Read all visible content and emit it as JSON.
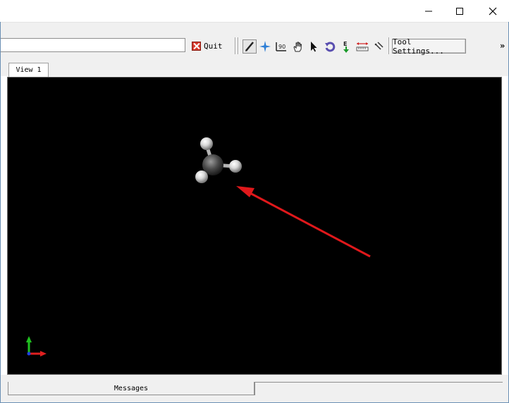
{
  "toolbar": {
    "quit_label": "Quit",
    "tool_settings_label": "Tool Settings...",
    "overflow_label": "»",
    "tools": [
      {
        "name": "draw-tool-icon"
      },
      {
        "name": "navigate-tool-icon"
      },
      {
        "name": "measure-angle-tool-icon"
      },
      {
        "name": "manipulate-hand-tool-icon"
      },
      {
        "name": "select-arrow-tool-icon"
      },
      {
        "name": "rotate-tool-icon"
      },
      {
        "name": "auto-optimize-tool-icon"
      },
      {
        "name": "ruler-measure-tool-icon"
      },
      {
        "name": "align-tool-icon"
      }
    ]
  },
  "tabs": {
    "view_label": "View 1"
  },
  "bottom": {
    "messages_label": "Messages"
  },
  "colors": {
    "viewport_bg": "#000000",
    "arrow": "#e0181b",
    "axis_x": "#e02020",
    "axis_y": "#20c020",
    "axis_z": "#2040e0"
  }
}
